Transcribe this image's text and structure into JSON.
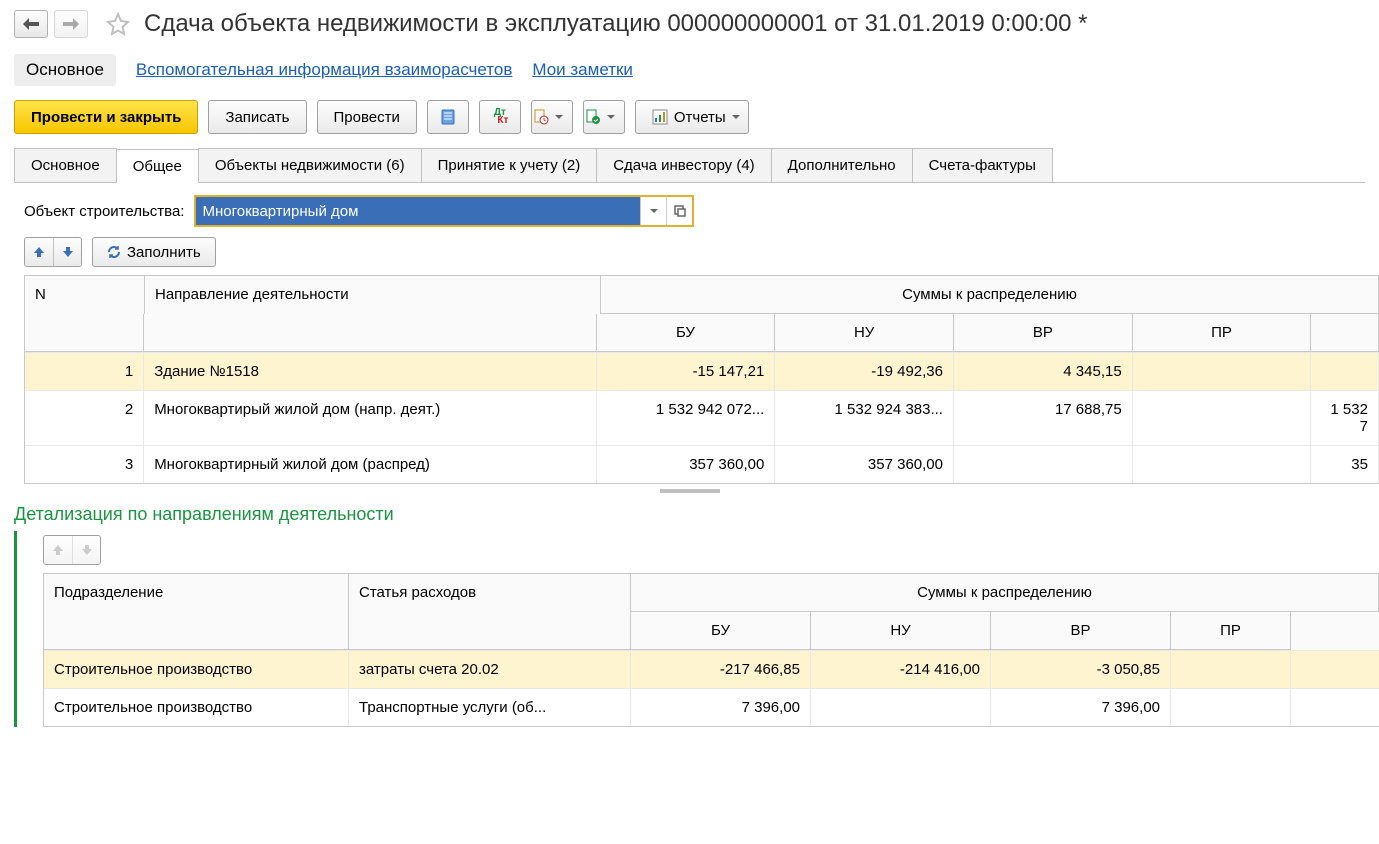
{
  "header": {
    "title": "Сдача объекта недвижимости в эксплуатацию 000000000001 от 31.01.2019 0:00:00 *"
  },
  "section_tabs": {
    "main": "Основное",
    "aux": "Вспомогательная информация взаиморасчетов",
    "notes": "Мои заметки"
  },
  "toolbar": {
    "post_close": "Провести и закрыть",
    "save": "Записать",
    "post": "Провести",
    "reports": "Отчеты"
  },
  "tabs": [
    {
      "id": "main",
      "label": "Основное"
    },
    {
      "id": "general",
      "label": "Общее",
      "active": true
    },
    {
      "id": "objects",
      "label": "Объекты недвижимости (6)"
    },
    {
      "id": "accept",
      "label": "Принятие к учету (2)"
    },
    {
      "id": "investor",
      "label": "Сдача инвестору (4)"
    },
    {
      "id": "extra",
      "label": "Дополнительно"
    },
    {
      "id": "invoices",
      "label": "Счета-фактуры"
    }
  ],
  "form": {
    "object_label": "Объект строительства:",
    "object_value": "Многоквартирный дом"
  },
  "small_toolbar": {
    "fill": "Заполнить"
  },
  "table": {
    "header": {
      "n": "N",
      "direction": "Направление деятельности",
      "sum": "Суммы к распределению",
      "bu": "БУ",
      "nu": "НУ",
      "vr": "ВР",
      "pr": "ПР"
    },
    "rows": [
      {
        "n": "1",
        "dir": "Здание №1518",
        "bu": "-15 147,21",
        "nu": "-19 492,36",
        "vr": "4 345,15",
        "pr": "",
        "extra": "",
        "selected": true
      },
      {
        "n": "2",
        "dir": "Многоквартирый жилой дом (напр. деят.)",
        "bu": "1 532 942 072...",
        "nu": "1 532 924 383...",
        "vr": "17 688,75",
        "pr": "",
        "extra": "1 532 7"
      },
      {
        "n": "3",
        "dir": "Многоквартирный жилой дом (распред)",
        "bu": "357 360,00",
        "nu": "357 360,00",
        "vr": "",
        "pr": "",
        "extra": "35"
      }
    ]
  },
  "detail": {
    "title": "Детализация по направлениям деятельности",
    "header": {
      "pod": "Подразделение",
      "stat": "Статья расходов",
      "sum": "Суммы к распределению",
      "bu": "БУ",
      "nu": "НУ",
      "vr": "ВР",
      "pr": "ПР"
    },
    "rows": [
      {
        "pod": "Строительное производство",
        "stat": "затраты счета 20.02",
        "bu": "-217 466,85",
        "nu": "-214 416,00",
        "vr": "-3 050,85",
        "pr": "",
        "selected": true
      },
      {
        "pod": "Строительное производство",
        "stat": "Транспортные услуги (об...",
        "bu": "7 396,00",
        "nu": "",
        "vr": "7 396,00",
        "pr": ""
      }
    ]
  }
}
